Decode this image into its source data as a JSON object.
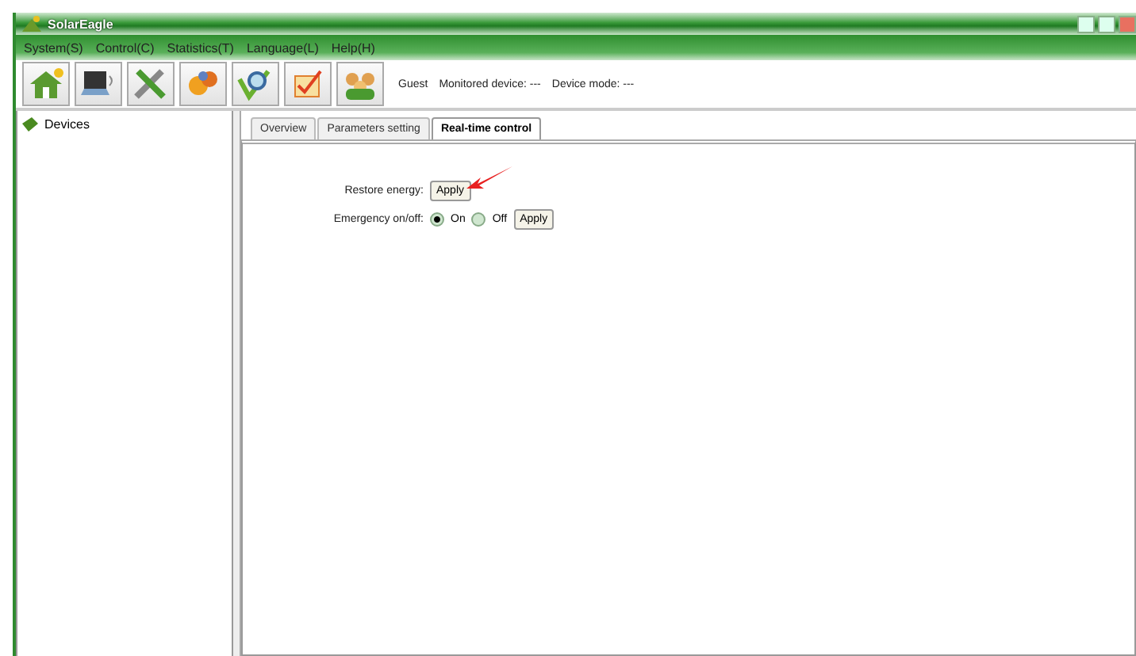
{
  "window": {
    "title": "SolarEagle"
  },
  "menu": [
    {
      "label": "System(S)"
    },
    {
      "label": "Control(C)"
    },
    {
      "label": "Statistics(T)"
    },
    {
      "label": "Language(L)"
    },
    {
      "label": "Help(H)"
    }
  ],
  "status": {
    "user": "Guest",
    "monitored_device": "Monitored device: ---",
    "device_mode": "Device mode: ---"
  },
  "tree": {
    "items": [
      {
        "label": "Devices"
      }
    ]
  },
  "tabs": [
    {
      "label": "Overview",
      "selected": false
    },
    {
      "label": "Parameters setting",
      "selected": false
    },
    {
      "label": "Real-time control",
      "selected": true
    }
  ],
  "controls": [
    {
      "kind": "button",
      "label": "Restore energy:",
      "button": "Apply"
    },
    {
      "kind": "radio",
      "label": "Emergency on/off:",
      "options": [
        {
          "label": "On",
          "selected": true
        },
        {
          "label": "Off",
          "selected": false
        }
      ],
      "button": "Apply"
    }
  ]
}
